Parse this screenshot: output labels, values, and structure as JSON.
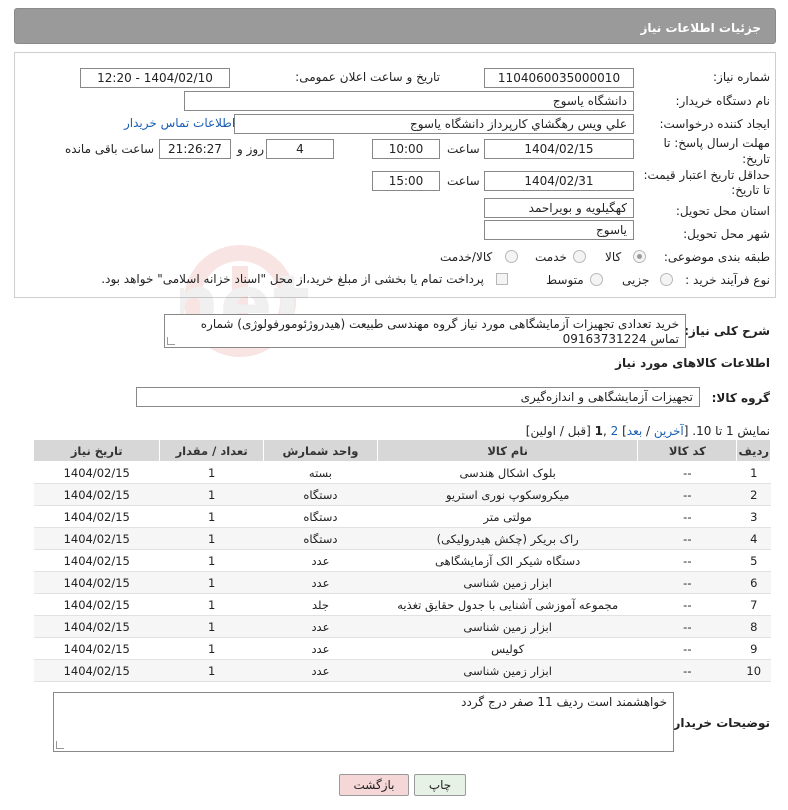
{
  "header": {
    "title": "جزئیات اطلاعات نیاز"
  },
  "form": {
    "need_number_label": "شماره نیاز:",
    "need_number": "1104060035000010",
    "announce_label": "تاریخ و ساعت اعلان عمومی:",
    "announce_value": "1404/02/10 - 12:20",
    "buyer_org_label": "نام دستگاه خریدار:",
    "buyer_org": "دانشگاه یاسوج",
    "creator_label": "ایجاد کننده درخواست:",
    "creator": "علي ويس رهگشاي كارپرداز دانشگاه ياسوج",
    "contact_link": "اطلاعات تماس خریدار",
    "deadline_label_1": "مهلت ارسال پاسخ: تا",
    "deadline_label_2": "تاریخ:",
    "deadline_date": "1404/02/15",
    "time_label": "ساعت",
    "deadline_time": "10:00",
    "days_value": "4",
    "days_label": "روز و",
    "remaining_time": "21:26:27",
    "remaining_label": "ساعت باقی مانده",
    "min_validity_label_1": "حداقل تاریخ اعتبار قیمت:",
    "min_validity_label_2": "تا تاریخ:",
    "validity_date": "1404/02/31",
    "validity_time": "15:00",
    "province_label": "استان محل تحویل:",
    "province": "کهگیلویه و بویراحمد",
    "city_label": "شهر محل تحویل:",
    "city": "یاسوج",
    "category_label": "طبقه بندی موضوعی:",
    "category_options": [
      "کالا",
      "خدمت",
      "کالا/خدمت"
    ],
    "category_selected": "کالا",
    "purchase_type_label": "نوع فرآیند خرید :",
    "purchase_options": [
      "جزیی",
      "متوسط"
    ],
    "payment_note": "پرداخت تمام یا بخشی از مبلغ خرید،از محل \"اسناد خزانه اسلامی\" خواهد بود."
  },
  "description": {
    "label": "شرح کلی نیاز:",
    "text": "خرید تعدادی تجهیزات آزمایشگاهی  مورد نیاز گروه مهندسی طبیعت (هیدروژئومورفولوژی) شماره تماس 09163731224"
  },
  "goods": {
    "section_title": "اطلاعات کالاهای مورد نیاز",
    "group_label": "گروه کالا:",
    "group_value": "تجهیزات آزمایشگاهی و اندازه‌گیری"
  },
  "pager": {
    "prefix": "نمایش 1 تا 10. [",
    "last": "آخرین",
    "sep1": " / ",
    "next": "بعد",
    "sep2": "] ",
    "page2": "2",
    "comma": " ,",
    "page1": "1",
    "suffix": " [قبل / اولین]"
  },
  "table": {
    "headers": [
      "ردیف",
      "کد کالا",
      "نام کالا",
      "واحد شمارش",
      "تعداد / مقدار",
      "تاریخ نیاز"
    ],
    "rows": [
      [
        "1",
        "--",
        "بلوک اشکال هندسی",
        "بسته",
        "1",
        "1404/02/15"
      ],
      [
        "2",
        "--",
        "میکروسکوپ نوری استریو",
        "دستگاه",
        "1",
        "1404/02/15"
      ],
      [
        "3",
        "--",
        "مولتی متر",
        "دستگاه",
        "1",
        "1404/02/15"
      ],
      [
        "4",
        "--",
        "راک بریکر (چکش هیدرولیکی)",
        "دستگاه",
        "1",
        "1404/02/15"
      ],
      [
        "5",
        "--",
        "دستگاه شیکر الک آزمایشگاهی",
        "عدد",
        "1",
        "1404/02/15"
      ],
      [
        "6",
        "--",
        "ابزار زمین شناسی",
        "عدد",
        "1",
        "1404/02/15"
      ],
      [
        "7",
        "--",
        "مجموعه آموزشی آشنایی با جدول حقایق تغذیه",
        "جلد",
        "1",
        "1404/02/15"
      ],
      [
        "8",
        "--",
        "ابزار زمین شناسی",
        "عدد",
        "1",
        "1404/02/15"
      ],
      [
        "9",
        "--",
        "کولیس",
        "عدد",
        "1",
        "1404/02/15"
      ],
      [
        "10",
        "--",
        "ابزار زمین شناسی",
        "عدد",
        "1",
        "1404/02/15"
      ]
    ]
  },
  "buyer_notes": {
    "label": "توضیحات خریدار:",
    "text": "خواهشمند است ردیف 11 صفر درج گردد"
  },
  "buttons": {
    "print": "چاپ",
    "back": "بازگشت"
  },
  "colors": {
    "header_bg": "#9a9a9a",
    "link": "#1a5fb4",
    "back_btn_bg": "#f6d7d7",
    "print_btn_bg": "#e6f2e6"
  }
}
